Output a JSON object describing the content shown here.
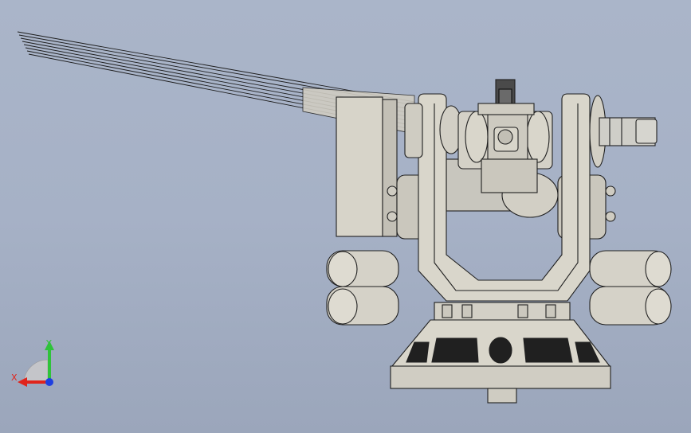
{
  "viewport": {
    "background_top": "#aab5c9",
    "background_bottom": "#9ba6bb"
  },
  "model": {
    "description": "",
    "body_color": "#d7d4c9",
    "edge_color": "#202020",
    "motor_color": "#c9c8c2"
  },
  "triad": {
    "x_label": "X",
    "y_label": "Y",
    "x_color": "#e0241c",
    "y_color": "#2fc33a",
    "z_color": "#1f3fe0"
  }
}
